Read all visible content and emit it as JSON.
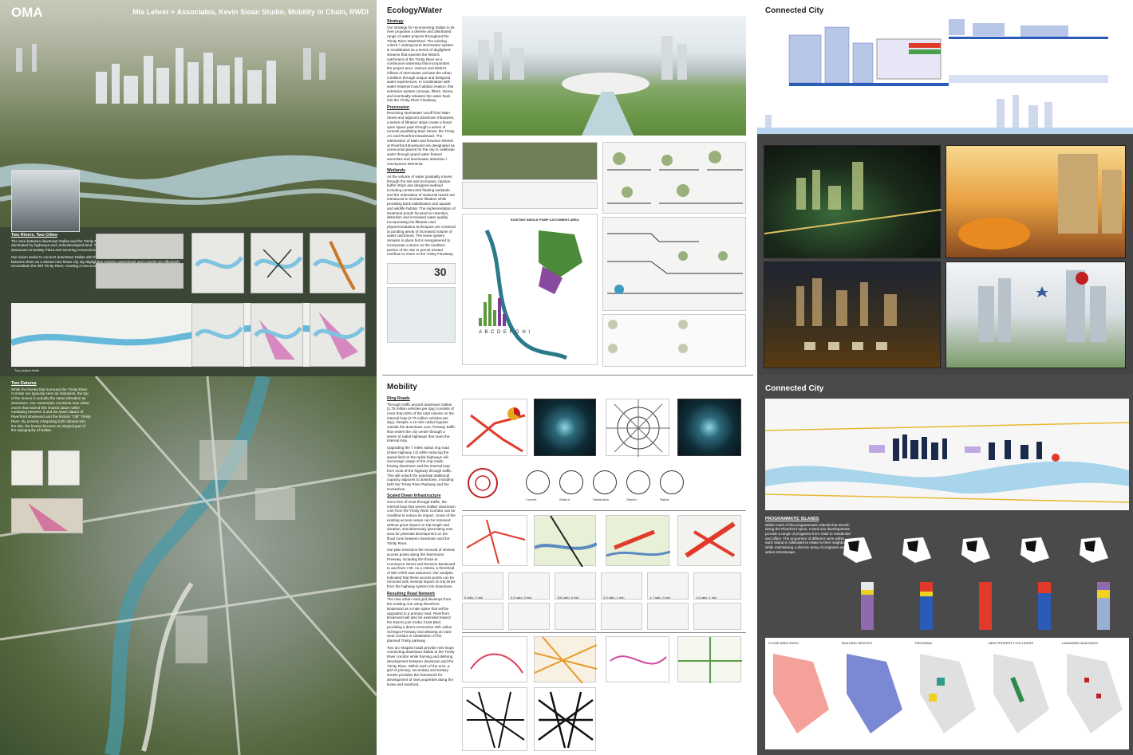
{
  "board1": {
    "title": "OMA",
    "team": "Mia Lehrer + Associates, Kevin Sloan Studio, Mobility in Chain, RWDI",
    "two_rivers": {
      "heading": "Two Rivers, Two Cities",
      "p1": "The area between downtown Dallas and the Trinity River Corridor, once the site of the river itself, is dominated by highways and underdeveloped land. This zone forms a moat around Dallas, truncating downtown at Dealey Plaza and severing connections between the city and the waterfront.",
      "p2": "Our vision seeks to connect downtown Dallas with the Trinity River Corridor and to reconceive the zone between them as a vibrant new linear city. By daylighting existing watersheds and culverts we effectively reconstitute the Old Trinity River, creating a new ecological and urban spine along Riverfront Boulevard."
    },
    "two_datums": {
      "heading": "Two Datums",
      "p1": "While the levees that surround the Trinity River Corridor are typically seen as obstacles, the top of the levees is actually the same elevation as downtown. Our masterplan envisions new urban zones that extend this shared datum while mediating between it and the lower datum of Riverfront Boulevard and the historic \"Old\" Trinity River. By actively integrating both datums into the site, the levees become an integral part of the topography of Dallas."
    },
    "strip_caption": "Two-project-limits"
  },
  "board2": {
    "ecology_title": "Ecology/Water",
    "mobility_title": "Mobility",
    "strategy": {
      "heading": "Strategy",
      "body": "Our strategy for reconnecting Dallas to its river proposes a diverse and distributed range of water projects throughout the Trinity River Watershed. The existing culvert / underground stormwater system is recalibrated as a series of daylighted streams that express the historic catchment of the Trinity River as a continuous waterway that incorporates the project area. Various and distinct inflows of stormwater activate the urban condition through unique and designed water experiences. In combination with water treatment and habitat creation, this extensive system conveys, filters, stores, and eventually releases the water back into the Trinity River Floodway."
    },
    "procession": {
      "heading": "Procession",
      "body": "Receiving stormwater runoff from Main Street and adjacent downtown tributaries, a series of filtration strips create a lineal open space park through a series of runnels paralleling Main Street, the Trinity Arc and Riverfront Boulevard. The intersection of Main and Reunion Streets at Riverfront Boulevard are designated as ceremonial places for the city to celebrate water through grand water feature amenities and stormwater detention / conveyance elements."
    },
    "wetlands": {
      "heading": "Wetlands",
      "body": "As the volume of water gradually moves through the site and increases, riparian buffer strips and designed wetland including constructed floating wetlands and the restoration of seasonal marsh are introduced to increase filtration while providing bank stabilization and aquatic and wildlife habitat. The implementation of treatment ponds focused on retention, detention and increased water quality. Incorporating bio-filtration and phytoremediation techniques are centered at ponding areas of increased volume of water catchment. The levee system remains in place but is reengineered to incorporate a sluice on the southern portion of the site to permit treated overflow to return to the Trinity Floodway."
    },
    "ring_roads": {
      "heading": "Ring Roads",
      "body": "Through traffic around downtown Dallas (1.75 million vehicles per day) consists of more than 50% of the total volume on the internal loop (0.75 million vehicles per day). Despite a 10 mile radius bypass outside the downtown core, freeway traffic flow enters the city center through a series of radial highways that meet the internal loop.",
      "body2": "Upgrading the 7 miles radius ring road (State Highway 12) while reducing the speed limit on the radial highways will encourage usage of the ring roads, freeing downtown and the internal loop from most of the highway through traffic. This will unlock the potential additional capacity adjacent to downtown, including both the Trinity River Parkway and the Horseshoe."
    },
    "scaled_down": {
      "heading": "Scaled Down Infrastructure",
      "body": "Once free of most through-traffic, the internal loop that severs Dallas' downtown core from the Trinity River Corridor can be modified to reduce its impact. Some of the existing access ramps can be removed without great impact on trip length and duration, simultaneously generating new area for potential development on the flood zone between downtown and the Trinity River.",
      "body2": "Our plan envisions the removal of several access points along the Stemmons Freeway, including the those at Commerce Street and Reunion Boulevard to and from I-30. As a criteria, a threshold of 500 veh/h was assumed. Our analysis indicated that these access points can be removed with minimal impact on trip times from the highway system into downtown."
    },
    "resulting": {
      "heading": "Resulting Road Network",
      "body": "The new urban road grid develops from the existing one using Riverfront Boulevard as a main spine that will be upgraded to a primary road. Riverfront Boulevard will also be extended toward the East to join Cedar Crest Blvd, providing a direct connection with Julius Schepps Freeway and allowing an east-west corridor in substitution of the planned Trinity parkway.",
      "body2": "Two arc-shaped roads provide new loops connecting downtown Dallas to the Trinity River corridor while framing and defining development between downtown and the Trinity River. Within each of the arcs, a grid of primary, secondary and tertiary streets provides the framework for development of new properties along the levee and riverfront."
    },
    "catchment_label": "EXISTING SINGLE PUMP CATCHMENT AREA",
    "chart_letters": "A   B   C D E F G H I",
    "big_number": "30",
    "ring_labels": [
      "Current",
      "Wide-in",
      "Distribution",
      "Stretch",
      "Radial"
    ],
    "scale_labels": [
      "0 ratio, 0 min",
      "0.5 ratio, 0 min",
      "100 ratio, 0 min",
      "2.0 ratio, 1 min",
      "1.7 ratio, 0 min",
      "1.5 ratio, 1 min"
    ]
  },
  "board3": {
    "title_top": "Connected City",
    "title_mid": "Connected City",
    "islands": {
      "heading": "PROGRAMMATIC ISLANDS",
      "body": "Within each of the programmatic islands that stretch along the Riverfront spine, mixed-use developments provide a range of programs from retail to residential and office. The proportion of different uses within each island is calibrated to relate to their neighbors while maintaining a diverse array of programs and an active streetscape."
    },
    "bottom_labels": [
      "FLOOR AREA RATIO",
      "BUILDING HEIGHTS",
      "PROGRAM",
      "NEW PROPERTY COLLIDERS",
      "LANDMARK BUILDINGS"
    ],
    "colors": {
      "red": "#e8302a",
      "blue": "#2a5bb8",
      "yellow": "#f0d020",
      "purple": "#8e6aae",
      "teal": "#2e9a8a"
    }
  }
}
